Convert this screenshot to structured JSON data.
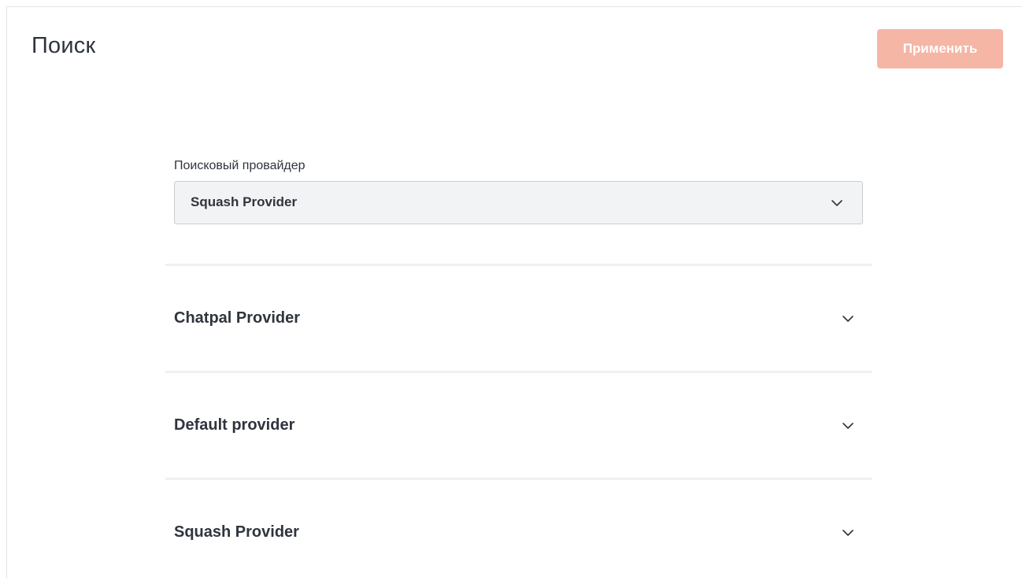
{
  "header": {
    "title": "Поиск",
    "apply_label": "Применить",
    "apply_color": "#f5b6a6"
  },
  "search_provider": {
    "label": "Поисковый провайдер",
    "selected": "Squash Provider",
    "icon": "chevron-down-icon"
  },
  "sections": [
    {
      "title": "Chatpal Provider",
      "icon": "chevron-down-icon",
      "expanded": false
    },
    {
      "title": "Default provider",
      "icon": "chevron-down-icon",
      "expanded": false
    },
    {
      "title": "Squash Provider",
      "icon": "chevron-down-icon",
      "expanded": false
    }
  ]
}
